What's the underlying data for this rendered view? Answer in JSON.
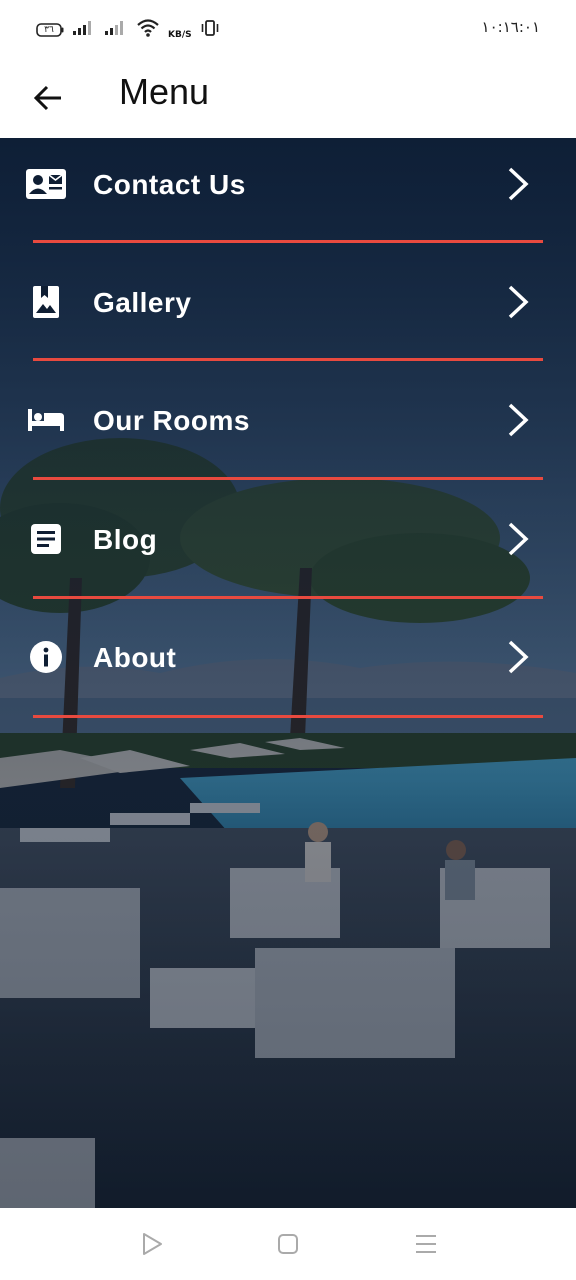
{
  "status_bar": {
    "battery": "٣٦",
    "net_speed_unit": "KB/S",
    "time": "١٠:١٦:٠١"
  },
  "app_bar": {
    "title": "Menu",
    "back_icon": "arrow-left-icon"
  },
  "menu": {
    "items": [
      {
        "label": "Contact Us",
        "icon": "contact-card-icon"
      },
      {
        "label": "Gallery",
        "icon": "image-bookmark-icon"
      },
      {
        "label": "Our Rooms",
        "icon": "bed-icon"
      },
      {
        "label": "Blog",
        "icon": "article-icon"
      },
      {
        "label": "About",
        "icon": "info-icon"
      }
    ],
    "chevron_icon": "chevron-right-icon"
  },
  "colors": {
    "divider": "#e84a3f",
    "overlay": "#0a182d",
    "text": "#ffffff"
  },
  "nav_bar": {
    "buttons": [
      "back-triangle-icon",
      "home-square-icon",
      "recents-menu-icon"
    ]
  }
}
